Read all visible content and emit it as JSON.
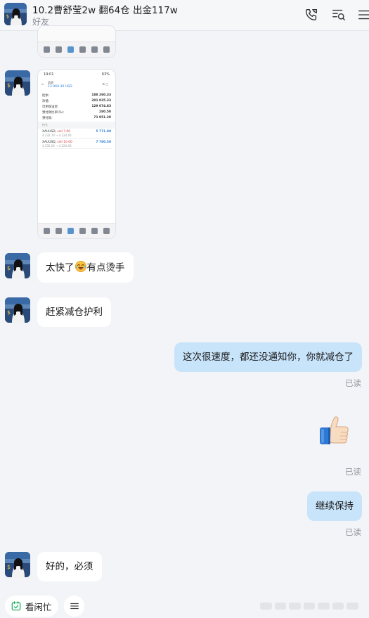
{
  "header": {
    "title": "10.2曹舒莹2w 翻64仓 出金117w",
    "subtitle": "好友",
    "icons": [
      "phone-call-icon",
      "search-chat-icon",
      "more-icon"
    ]
  },
  "messages": [
    {
      "type": "image",
      "side": "left",
      "desc": "phone-screenshot-partial"
    },
    {
      "type": "image",
      "side": "left",
      "desc": "phone-screenshot-trading"
    },
    {
      "type": "text",
      "side": "left",
      "text_before": "太快了",
      "emoji": "tears-of-joy",
      "text_after": "有点烫手"
    },
    {
      "type": "text",
      "side": "left",
      "text": "赶紧减仓护利"
    },
    {
      "type": "text",
      "side": "right",
      "text": "这次很速度，都还没通知你，你就减仓了",
      "status": "已读"
    },
    {
      "type": "sticker",
      "side": "right",
      "emoji": "thumbs-up",
      "status": "已读"
    },
    {
      "type": "text",
      "side": "right",
      "text": "继续保持",
      "status": "已读"
    },
    {
      "type": "text",
      "side": "left",
      "text": "好的，必须"
    }
  ],
  "screenshot": {
    "time": "19:01",
    "battery": "63%",
    "account_label": "总资",
    "account_value": "13 960.30 USD",
    "rows": [
      {
        "label": "结余:",
        "value": "188 260.33"
      },
      {
        "label": "净值:",
        "value": "201 025.33"
      },
      {
        "label": "可用保证金:",
        "value": "129 074.83"
      },
      {
        "label": "预付款比率(%):",
        "value": "280.50"
      },
      {
        "label": "预付款:",
        "value": "71 951.20"
      }
    ],
    "section": "持仓",
    "positions": [
      {
        "symbol": "XAUUSD,",
        "side": "sell 7.00",
        "prices": "4 232.70 → 4 224.46",
        "value": "5 771.80"
      },
      {
        "symbol": "XAUUSD,",
        "side": "sell 10.00",
        "prices": "4 232.24 → 4 224.46",
        "value": "7 780.50"
      }
    ]
  },
  "bottom": {
    "button1": "看闲忙",
    "button2_icon": "menu-icon"
  },
  "colors": {
    "background": "#f3f4f7",
    "right_bubble": "#c8e4fb",
    "left_bubble": "#ffffff",
    "accent_green": "#1aad5b"
  }
}
